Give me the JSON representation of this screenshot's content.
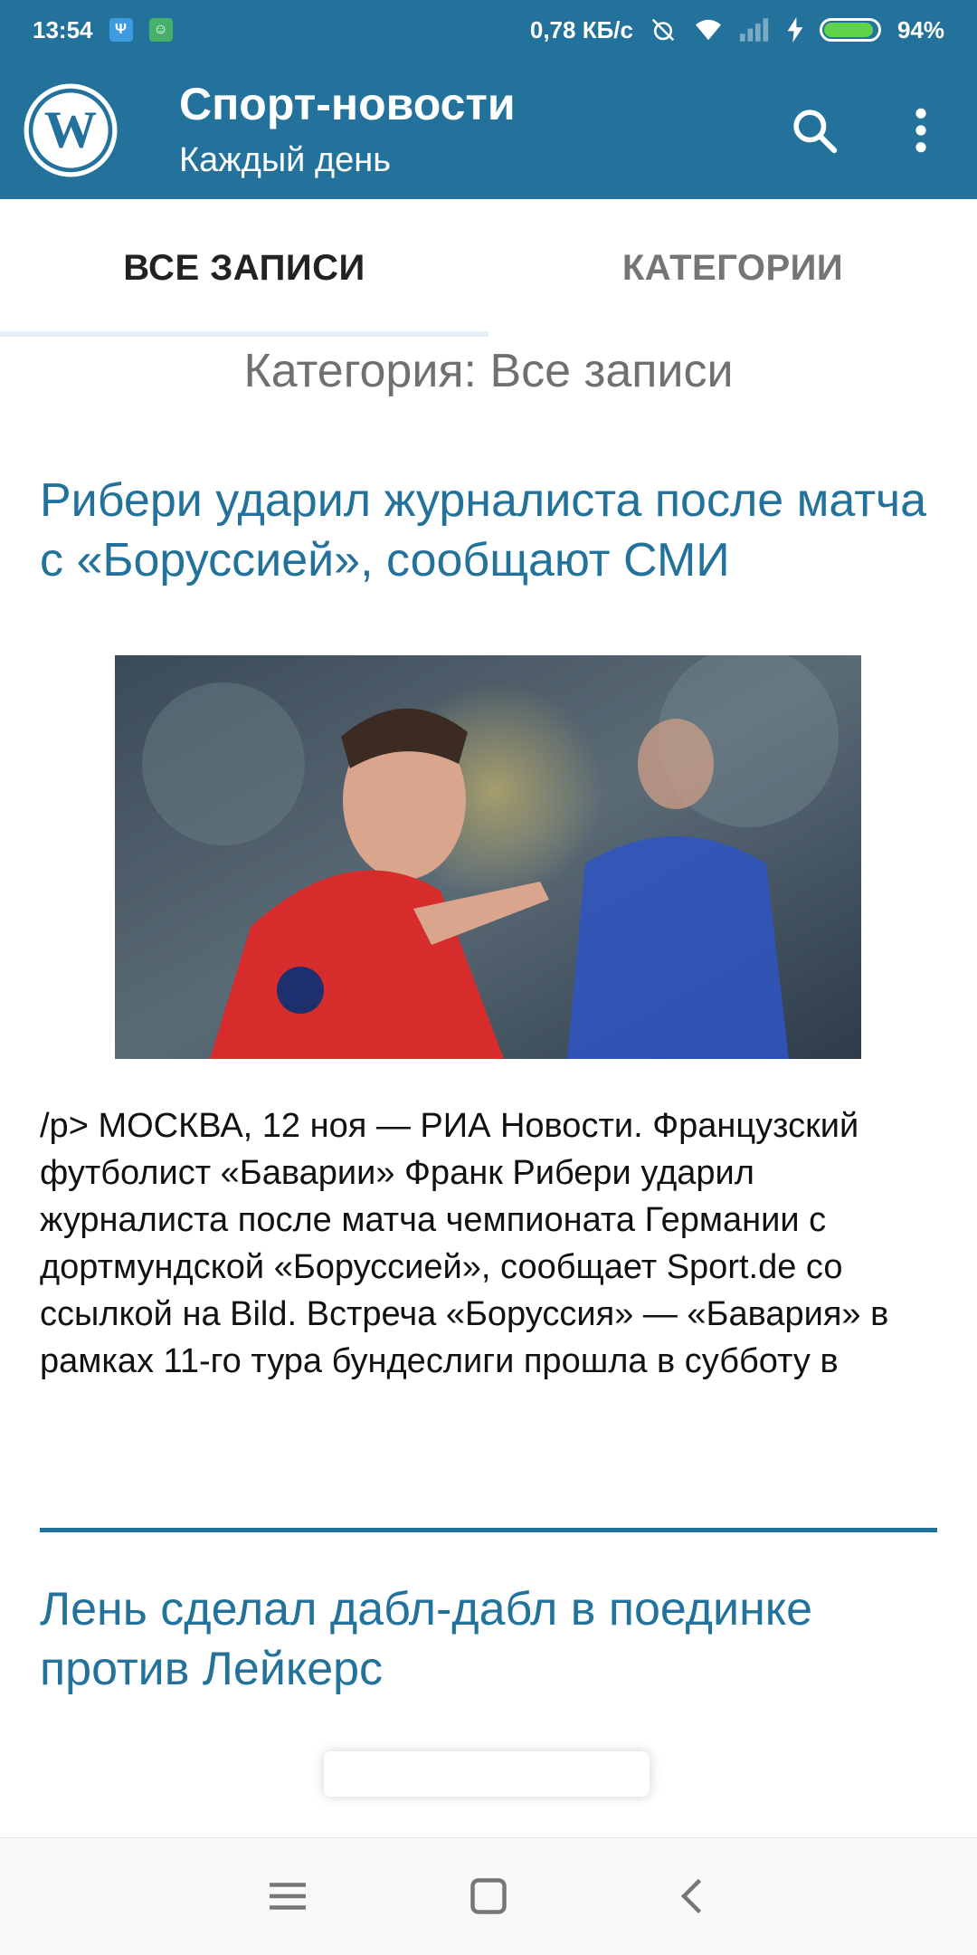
{
  "status_bar": {
    "time": "13:54",
    "network_speed": "0,78 КБ/с",
    "battery_percent": "94%",
    "battery_level": 0.94,
    "icons": [
      "usb-icon",
      "android-debug-icon",
      "alarm-off-icon",
      "wifi-icon",
      "signal-icon",
      "charging-icon",
      "battery-icon"
    ]
  },
  "app_bar": {
    "title": "Спорт-новости",
    "subtitle": "Каждый день",
    "icons": [
      "wordpress-logo-icon",
      "search-icon",
      "more-vert-icon"
    ]
  },
  "tabs": [
    {
      "label": "ВСЕ ЗАПИСИ",
      "active": true
    },
    {
      "label": "КАТЕГОРИИ",
      "active": false
    }
  ],
  "category_heading": "Категория: Все записи",
  "posts": [
    {
      "title": "Рибери ударил журналиста после матча с «Боруссией», сообщают СМИ",
      "excerpt": "/p> МОСКВА, 12 ноя — РИА Новости. Французский футболист «Баварии» Франк Рибери ударил журналиста после матча чемпионата Германии с дортмундской «Боруссией», сообщает Sport.de со ссылкой на Bild. Встреча «Боруссия» — «Бавария» в рамках 11-го тура бундеслиги прошла в субботу в"
    },
    {
      "title": "Лень сделал дабл-дабл в поединке против Лейкерс"
    }
  ],
  "colors": {
    "primary": "#23729b",
    "text": "#111111",
    "muted": "#707070"
  },
  "nav_bar": {
    "icons": [
      "menu-icon",
      "home-square-icon",
      "back-icon"
    ]
  }
}
